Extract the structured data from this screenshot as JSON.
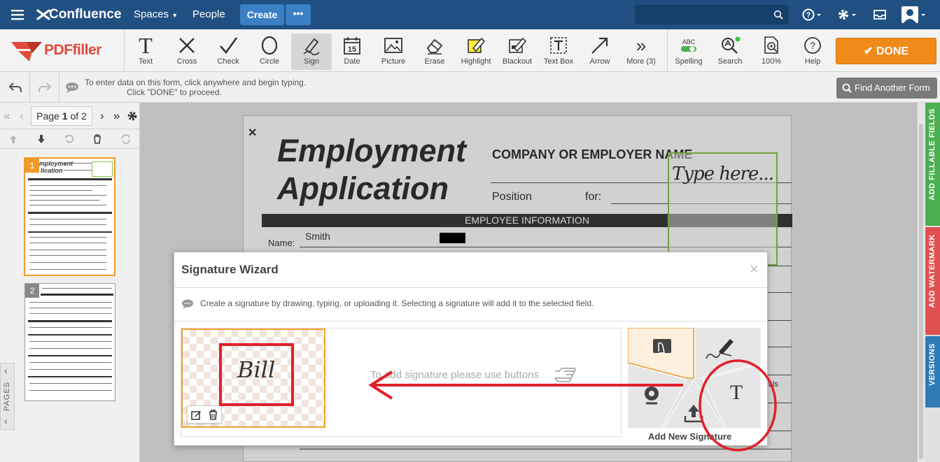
{
  "confluence": {
    "logo": "Confluence",
    "spaces": "Spaces",
    "people": "People",
    "create": "Create",
    "more": "•••"
  },
  "toolbar": {
    "brand": "PDFfiller",
    "tools": [
      {
        "label": "Text"
      },
      {
        "label": "Cross"
      },
      {
        "label": "Check"
      },
      {
        "label": "Circle"
      },
      {
        "label": "Sign"
      },
      {
        "label": "Date"
      },
      {
        "label": "Picture"
      },
      {
        "label": "Erase"
      },
      {
        "label": "Highlight"
      },
      {
        "label": "Blackout"
      },
      {
        "label": "Text Box"
      },
      {
        "label": "Arrow"
      },
      {
        "label": "More (3)"
      },
      {
        "label": "Spelling"
      },
      {
        "label": "Search"
      },
      {
        "label": "100%"
      },
      {
        "label": "Help"
      }
    ],
    "text_icon": "T",
    "more_icon": "»",
    "spelling_abc": "ABC",
    "done": "DONE"
  },
  "infobar": {
    "hint_line1": "To enter data on this form, click anywhere and begin typing.",
    "hint_line2": "Click \"DONE\" to proceed.",
    "find_another": "Find Another Form"
  },
  "pages": {
    "label_pre": "Page",
    "current": "1",
    "label_of": "of 2",
    "side_label": "PAGES",
    "thumb1_num": "1",
    "thumb2_num": "2",
    "thumb1_title_l1": "mployment",
    "thumb1_title_l2": "lication"
  },
  "document": {
    "title_line1": "Employment",
    "title_line2": "Application",
    "company_label": "COMPANY OR EMPLOYER NAME",
    "position_label": "Position",
    "for_label": "for:",
    "section_title": "EMPLOYEE INFORMATION",
    "name_label": "Name:",
    "name_value": "Smith",
    "type_here": "Type here...",
    "close_x": "✕",
    "partial_text": "erals"
  },
  "dialog": {
    "title": "Signature Wizard",
    "close": "×",
    "info": "Create a signature by drawing, typing, or uploading it. Selecting a signature will add it to the selected field.",
    "signature_text": "Bill",
    "empty_hint": "To add signature please use buttons",
    "add_new": "Add New Signature",
    "type_t": "T"
  },
  "right_tabs": {
    "fillable": "ADD FILLABLE FIELDS",
    "watermark": "ADD WATERMARK",
    "versions": "VERSIONS"
  },
  "colors": {
    "confluence_blue": "#205081",
    "done_orange": "#f08a1a",
    "green_tab": "#4caf50",
    "red_tab": "#e05050",
    "blue_tab": "#2e7bb8",
    "annotation_red": "#e0202a"
  }
}
